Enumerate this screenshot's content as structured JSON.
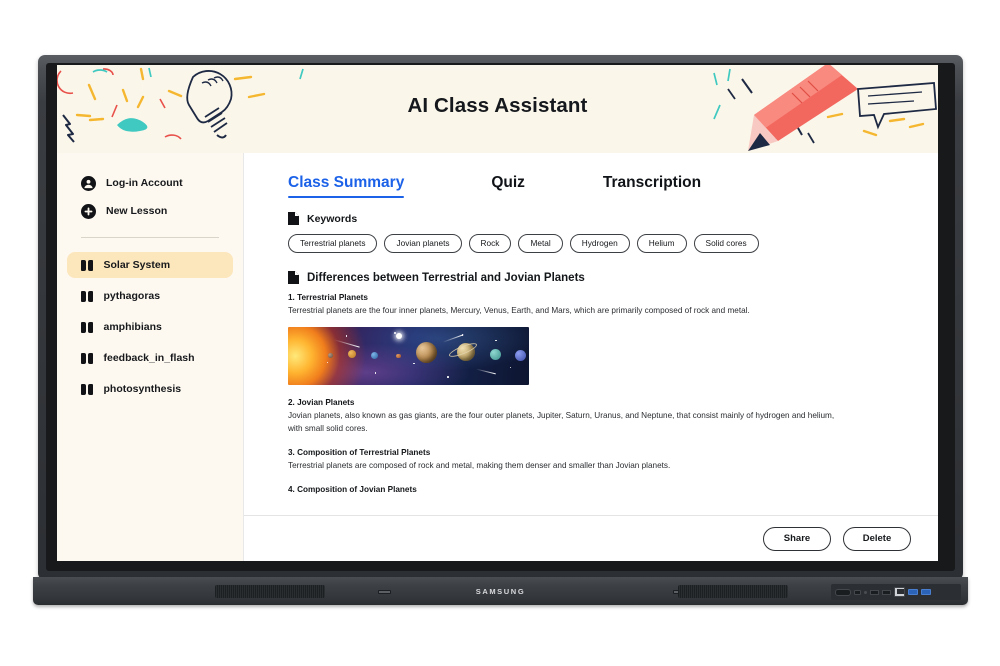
{
  "app": {
    "title": "AI Class Assistant",
    "brand": "SAMSUNG"
  },
  "colors": {
    "accent": "#1C62E8",
    "header_bg": "#FBF6EA",
    "sidebar_bg": "#FDF9F0",
    "selected_lesson_bg": "#FCE6BC",
    "text": "#14171A",
    "doodle_yellow": "#F5B730",
    "doodle_red": "#E8504A",
    "doodle_teal": "#3FC9C0",
    "doodle_navy": "#1E2A44",
    "pencil_red": "#F2685E"
  },
  "sidebar": {
    "top_items": [
      {
        "label": "Log-in Account",
        "icon": "account-circle-icon"
      },
      {
        "label": "New Lesson",
        "icon": "plus-circle-icon"
      }
    ],
    "lessons": [
      {
        "label": "Solar System",
        "selected": true
      },
      {
        "label": "pythagoras",
        "selected": false
      },
      {
        "label": "amphibians",
        "selected": false
      },
      {
        "label": "feedback_in_flash",
        "selected": false
      },
      {
        "label": "photosynthesis",
        "selected": false
      }
    ]
  },
  "main": {
    "tabs": [
      {
        "label": "Class Summary",
        "active": true
      },
      {
        "label": "Quiz",
        "active": false
      },
      {
        "label": "Transcription",
        "active": false
      }
    ],
    "keywords_section": {
      "heading": "Keywords",
      "icon": "document-icon",
      "chips": [
        "Terrestrial planets",
        "Jovian planets",
        "Rock",
        "Metal",
        "Hydrogen",
        "Helium",
        "Solid cores"
      ]
    },
    "summary_section": {
      "heading": "Differences between Terrestrial and Jovian Planets",
      "icon": "document-icon",
      "blocks": [
        {
          "head": "1. Terrestrial Planets",
          "body": "Terrestrial planets are the four inner planets, Mercury, Venus, Earth, and Mars, which are primarily composed of rock and metal.",
          "has_image": true,
          "image_alt": "solar-system-illustration"
        },
        {
          "head": "2. Jovian Planets",
          "body": "Jovian planets, also known as gas giants, are the four outer planets, Jupiter, Saturn, Uranus, and Neptune, that consist mainly of hydrogen and helium, with small solid cores.",
          "has_image": false
        },
        {
          "head": "3. Composition of Terrestrial Planets",
          "body": "Terrestrial planets are composed of rock and metal, making them denser and smaller than Jovian planets.",
          "has_image": false
        },
        {
          "head": "4. Composition of Jovian Planets",
          "body": "",
          "has_image": false
        }
      ]
    },
    "footer": {
      "share_label": "Share",
      "delete_label": "Delete"
    }
  }
}
